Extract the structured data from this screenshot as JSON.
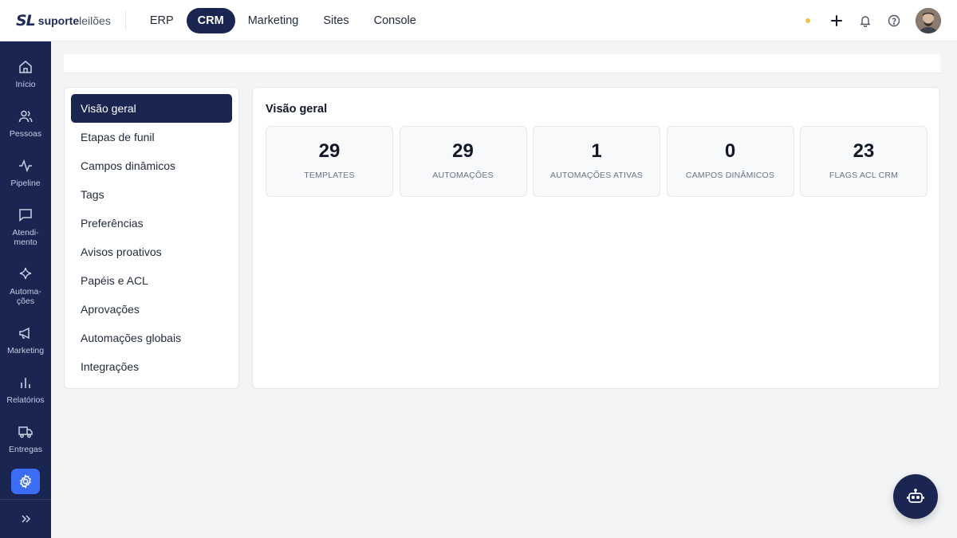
{
  "logo": {
    "mark": "SL",
    "text_bold": "suporte",
    "text_light": "leilões"
  },
  "modules": [
    {
      "label": "ERP",
      "active": false
    },
    {
      "label": "CRM",
      "active": true
    },
    {
      "label": "Marketing",
      "active": false
    },
    {
      "label": "Sites",
      "active": false
    },
    {
      "label": "Console",
      "active": false
    }
  ],
  "sidebar": {
    "items": [
      {
        "label": "Início",
        "icon": "home-icon"
      },
      {
        "label": "Pessoas",
        "icon": "users-icon"
      },
      {
        "label": "Pipeline",
        "icon": "activity-icon"
      },
      {
        "label": "Atendi-\nmento",
        "icon": "message-icon"
      },
      {
        "label": "Automa-\nções",
        "icon": "sparkle-icon"
      },
      {
        "label": "Marketing",
        "icon": "megaphone-icon"
      },
      {
        "label": "Relatórios",
        "icon": "bar-chart-icon"
      },
      {
        "label": "Entregas",
        "icon": "truck-icon"
      }
    ],
    "active_icon": "gear-icon"
  },
  "settings_menu": {
    "items": [
      "Visão geral",
      "Etapas de funil",
      "Campos dinâmicos",
      "Tags",
      "Preferências",
      "Avisos proativos",
      "Papéis e ACL",
      "Aprovações",
      "Automações globais",
      "Integrações"
    ],
    "active_index": 0
  },
  "overview": {
    "title": "Visão geral",
    "stats": [
      {
        "value": "29",
        "label": "TEMPLATES"
      },
      {
        "value": "29",
        "label": "AUTOMAÇÕES"
      },
      {
        "value": "1",
        "label": "AUTOMAÇÕES ATIVAS"
      },
      {
        "value": "0",
        "label": "CAMPOS DINÂMICOS"
      },
      {
        "value": "23",
        "label": "FLAGS ACL CRM"
      }
    ]
  },
  "colors": {
    "navy": "#1b2552",
    "accent": "#3b6ef5",
    "status_dot": "#f5c04a"
  }
}
